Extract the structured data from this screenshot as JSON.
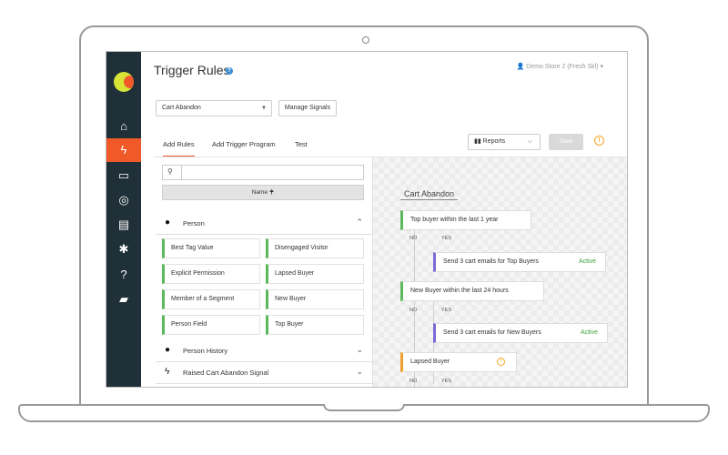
{
  "header": {
    "title": "Trigger Rules",
    "help_icon": "?",
    "account": "Demo Store 2 (Fresh Skl)",
    "account_caret": "▾"
  },
  "toolbar": {
    "program_select": "Cart Abandon",
    "select_caret": "▼",
    "manage_signals": "Manage Signals",
    "reports": "Reports",
    "reports_caret": "⌵",
    "save": "Save",
    "warning_icon": "!"
  },
  "tabs": [
    {
      "label": "Add Rules"
    },
    {
      "label": "Add Trigger Program"
    },
    {
      "label": "Test"
    }
  ],
  "panel": {
    "search_placeholder": "",
    "sort_label": "Name 🠉",
    "groups": [
      {
        "label": "Person",
        "chevron": "⌃"
      },
      {
        "label": "Person History",
        "chevron": "⌄"
      },
      {
        "label": "Raised Cart Abandon Signal",
        "chevron": "⌄"
      }
    ],
    "rules": [
      "Best Tag Value",
      "Disengaged Visitor",
      "Explicit Permission",
      "Lapsed Buyer",
      "Member of a Segment",
      "New Buyer",
      "Person Field",
      "Top Buyer"
    ]
  },
  "flow": {
    "title": "Cart Abandon",
    "no": "NO",
    "yes": "YES",
    "nodes": [
      {
        "label": "Top buyer within the last 1 year"
      },
      {
        "label": "Send 3 cart emails for Top Buyers",
        "status": "Active"
      },
      {
        "label": "New Buyer within the last 24 hours"
      },
      {
        "label": "Send 3 cart emails for New Buyers",
        "status": "Active"
      },
      {
        "label": "Lapsed Buyer"
      }
    ]
  },
  "sidebar": {
    "icons": [
      "home-icon",
      "bolt-icon",
      "card-icon",
      "target-icon",
      "clipboard-icon",
      "gear-icon",
      "help-icon",
      "folder-icon"
    ],
    "glyphs": [
      "⌂",
      "ϟ",
      "▭",
      "◎",
      "▤",
      "✱",
      "?",
      "▰"
    ]
  },
  "colors": {
    "sidebar": "#1f3038",
    "accent": "#f05a28",
    "rule_border": "#5cb85c",
    "action_border": "#7b6bd6",
    "warning": "#f5a623",
    "active_status": "#3c9f3c"
  }
}
